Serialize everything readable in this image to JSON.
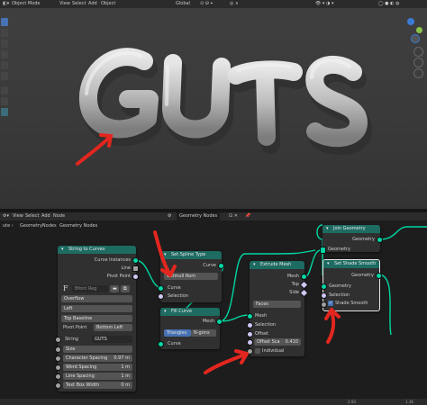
{
  "viewport": {
    "mode": "Object Mode",
    "menus": [
      "View",
      "Select",
      "Add",
      "Object"
    ],
    "transform": "Global",
    "object_text": "GUTS"
  },
  "node_editor": {
    "menus": [
      "View",
      "Select",
      "Add",
      "Node"
    ],
    "tree_name": "Geometry Nodes",
    "breadcrumb": [
      "GeometryNodes",
      "Geometry Nodes"
    ]
  },
  "nodes": {
    "string_to_curves": {
      "title": "String to Curves",
      "out_curve_instances": "Curve Instances",
      "out_line": "Line",
      "out_pivot": "Pivot Point",
      "font": "Bfont Reg",
      "overflow": "Overflow",
      "align_x": "Left",
      "align_y": "Top Baseline",
      "pivot_label": "Pivot Point",
      "pivot_value": "Bottom Left",
      "string_label": "String",
      "string_value": "GUTS",
      "size": "Size",
      "character_spacing_label": "Character Spacing",
      "character_spacing_value": "0.97 m",
      "word_spacing_label": "Word Spacing",
      "word_spacing_value": "1 m",
      "line_spacing_label": "Line Spacing",
      "line_spacing_value": "1 m",
      "text_box_width_label": "Text Box Width",
      "text_box_width_value": "0 m"
    },
    "set_spline_type": {
      "title": "Set Spline Type",
      "out_curve": "Curve",
      "type": "Catmull Rom",
      "in_curve": "Curve",
      "in_selection": "Selection"
    },
    "fill_curve": {
      "title": "Fill Curve",
      "out_mesh": "Mesh",
      "mode_triangles": "Triangles",
      "mode_ngons": "N-gons",
      "in_curve": "Curve"
    },
    "extrude_mesh": {
      "title": "Extrude Mesh",
      "out_mesh": "Mesh",
      "out_top": "Top",
      "out_side": "Side",
      "mode": "Faces",
      "in_mesh": "Mesh",
      "in_selection": "Selection",
      "in_offset": "Offset",
      "offset_scale_label": "Offset Sca",
      "offset_scale_value": "0.410",
      "individual": "Individual"
    },
    "join_geometry": {
      "title": "Join Geometry",
      "out_geometry": "Geometry",
      "in_geometry": "Geometry"
    },
    "set_shade_smooth": {
      "title": "Set Shade Smooth",
      "out_geometry": "Geometry",
      "in_geometry": "Geometry",
      "in_selection": "Selection",
      "shade_smooth": "Shade Smooth"
    }
  },
  "status": {
    "left": "",
    "right": [
      "2.93",
      "1.16"
    ]
  },
  "colors": {
    "geometry_socket": "#00d6a3",
    "field_socket": "#cfc7f5",
    "annotation_red": "#e3261f",
    "node_header": "#1e6b62"
  }
}
